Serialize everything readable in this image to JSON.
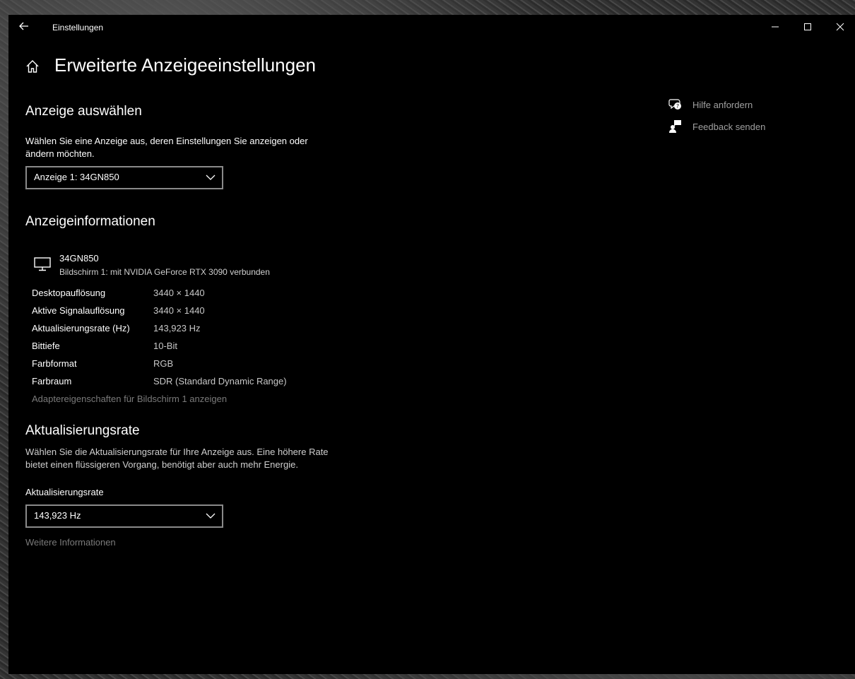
{
  "window": {
    "app_title": "Einstellungen"
  },
  "page": {
    "title": "Erweiterte Anzeigeeinstellungen"
  },
  "select_display": {
    "heading": "Anzeige auswählen",
    "description": "Wählen Sie eine Anzeige aus, deren Einstellungen Sie anzeigen oder ändern möchten.",
    "selected": "Anzeige 1: 34GN850"
  },
  "display_info": {
    "heading": "Anzeigeinformationen",
    "monitor_name": "34GN850",
    "monitor_subtitle": "Bildschirm 1: mit NVIDIA GeForce RTX 3090 verbunden",
    "rows": [
      {
        "key": "Desktopauflösung",
        "value": "3440 × 1440"
      },
      {
        "key": "Aktive Signalauflösung",
        "value": "3440 × 1440"
      },
      {
        "key": "Aktualisierungsrate (Hz)",
        "value": "143,923 Hz"
      },
      {
        "key": "Bittiefe",
        "value": "10-Bit"
      },
      {
        "key": "Farbformat",
        "value": "RGB"
      },
      {
        "key": "Farbraum",
        "value": "SDR (Standard Dynamic Range)"
      }
    ],
    "adapter_link": "Adaptereigenschaften für Bildschirm 1 anzeigen"
  },
  "refresh_rate": {
    "heading": "Aktualisierungsrate",
    "description": "Wählen Sie die Aktualisierungsrate für Ihre Anzeige aus. Eine höhere Rate bietet einen flüssigeren Vorgang, benötigt aber auch mehr Energie.",
    "label": "Aktualisierungsrate",
    "selected": "143,923 Hz",
    "more_link": "Weitere Informationen"
  },
  "sidebar": {
    "help": "Hilfe anfordern",
    "feedback": "Feedback senden"
  },
  "icons": {
    "back": "back-arrow-icon",
    "home": "home-icon",
    "minimize": "minimize-icon",
    "maximize": "maximize-icon",
    "close": "close-icon",
    "monitor": "monitor-icon",
    "chevron": "chevron-down-icon",
    "help": "help-chat-icon",
    "feedback": "feedback-person-icon"
  },
  "colors": {
    "window_bg": "#000000",
    "text": "#ffffff",
    "secondary_text": "#c8c8c8",
    "link_disabled": "#7a7a7a",
    "dropdown_border": "#8a8a8a"
  }
}
